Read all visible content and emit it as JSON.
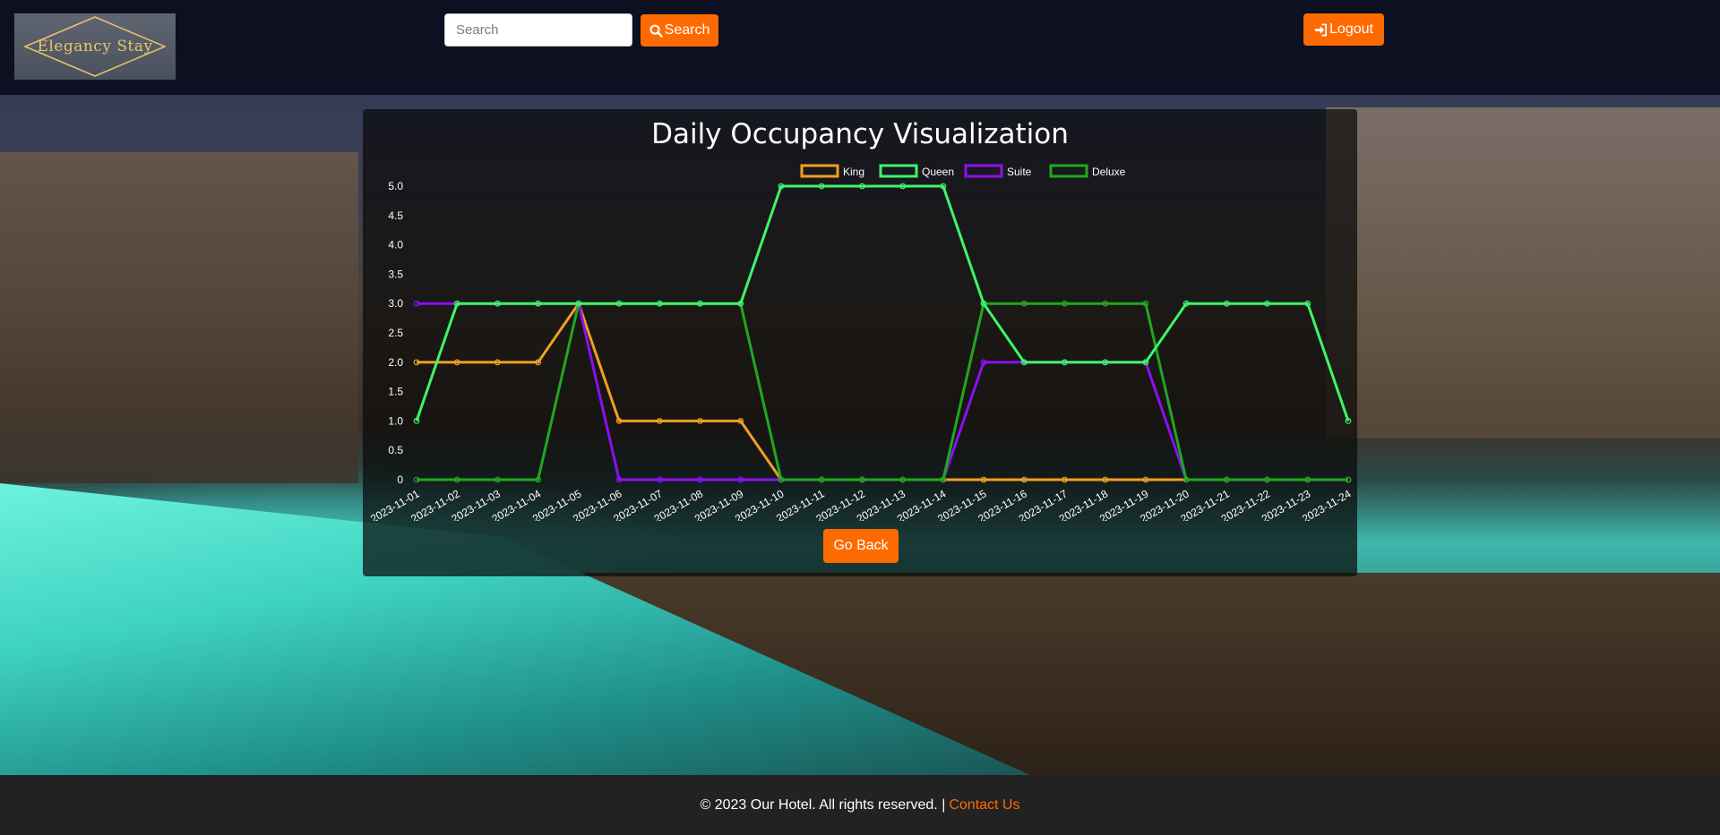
{
  "brand": {
    "name": "Elegancy Stay"
  },
  "search": {
    "placeholder": "Search",
    "button_label": "Search",
    "button_icon": "search-icon"
  },
  "nav": {
    "logout_label": "Logout",
    "logout_icon": "sign-in-icon"
  },
  "colors": {
    "accent": "#ff6a00",
    "king": "#f0a020",
    "queen": "#3df56a",
    "suite": "#8a10f0",
    "deluxe": "#1fa81f"
  },
  "page": {
    "go_back_label": "Go Back"
  },
  "footer": {
    "copyright": "© 2023 Our Hotel. All rights reserved. |",
    "contact_label": "Contact Us"
  },
  "chart_data": {
    "type": "line",
    "title": "Daily Occupancy Visualization",
    "legend_position": "top",
    "ylim": [
      0,
      5
    ],
    "yticks": [
      "0",
      "0.5",
      "1.0",
      "1.5",
      "2.0",
      "2.5",
      "3.0",
      "3.5",
      "4.0",
      "4.5",
      "5.0"
    ],
    "x": [
      "2023-11-01",
      "2023-11-02",
      "2023-11-03",
      "2023-11-04",
      "2023-11-05",
      "2023-11-06",
      "2023-11-07",
      "2023-11-08",
      "2023-11-09",
      "2023-11-10",
      "2023-11-11",
      "2023-11-12",
      "2023-11-13",
      "2023-11-14",
      "2023-11-15",
      "2023-11-16",
      "2023-11-17",
      "2023-11-18",
      "2023-11-19",
      "2023-11-20",
      "2023-11-21",
      "2023-11-22",
      "2023-11-23",
      "2023-11-24"
    ],
    "series": [
      {
        "name": "King",
        "color": "#f0a020",
        "values": [
          2,
          2,
          2,
          2,
          3,
          1,
          1,
          1,
          1,
          0,
          0,
          0,
          0,
          0,
          0,
          0,
          0,
          0,
          0,
          0,
          0,
          0,
          0,
          0
        ]
      },
      {
        "name": "Suite",
        "color": "#8a10f0",
        "values": [
          3,
          3,
          3,
          3,
          3,
          0,
          0,
          0,
          0,
          0,
          0,
          0,
          0,
          0,
          2,
          2,
          2,
          2,
          2,
          0,
          0,
          0,
          0,
          0
        ]
      },
      {
        "name": "Deluxe",
        "color": "#1fa81f",
        "values": [
          0,
          0,
          0,
          0,
          3,
          3,
          3,
          3,
          3,
          0,
          0,
          0,
          0,
          0,
          3,
          3,
          3,
          3,
          3,
          0,
          0,
          0,
          0,
          0
        ]
      },
      {
        "name": "Queen",
        "color": "#3df56a",
        "values": [
          1,
          3,
          3,
          3,
          3,
          3,
          3,
          3,
          3,
          5,
          5,
          5,
          5,
          5,
          3,
          2,
          2,
          2,
          2,
          3,
          3,
          3,
          3,
          1
        ]
      }
    ],
    "legend_order": [
      "King",
      "Queen",
      "Suite",
      "Deluxe"
    ]
  }
}
